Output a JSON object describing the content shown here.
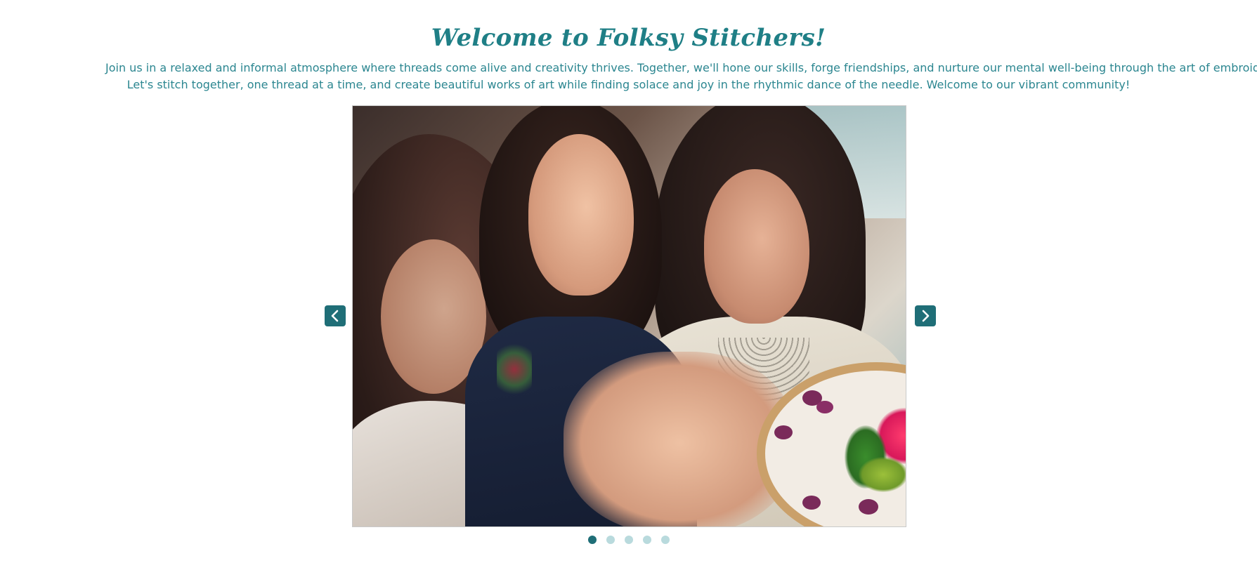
{
  "header": {
    "title": "Welcome to Folksy Stitchers!"
  },
  "intro": {
    "line1": "Join us in a relaxed and informal atmosphere where threads come alive and creativity thrives. Together, we'll hone our skills, forge friendships, and nurture our mental well-being through the art of embroidery.",
    "line2": "Let's stitch together, one thread at a time, and create beautiful works of art while finding solace and joy in the rhythmic dance of the needle. Welcome to our vibrant community!"
  },
  "carousel": {
    "current_slide": 1,
    "total_slides": 5,
    "prev_icon": "chevron-left-icon",
    "next_icon": "chevron-right-icon"
  },
  "colors": {
    "accent": "#1f6e77",
    "text": "#2a7d86",
    "dot_inactive": "#b9dadd"
  }
}
